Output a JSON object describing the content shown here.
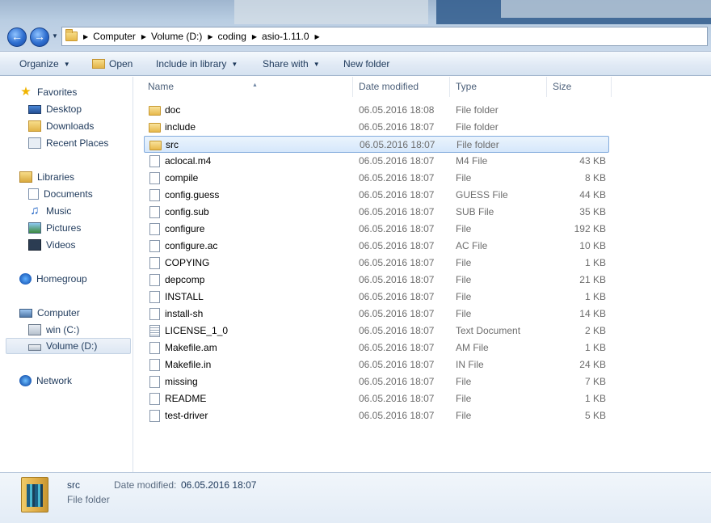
{
  "address": {
    "crumbs": [
      "Computer",
      "Volume (D:)",
      "coding",
      "asio-1.11.0"
    ]
  },
  "toolbar": {
    "organize": "Organize",
    "open": "Open",
    "include_in_library": "Include in library",
    "share_with": "Share with",
    "new_folder": "New folder"
  },
  "nav": {
    "favorites": "Favorites",
    "desktop": "Desktop",
    "downloads": "Downloads",
    "recent_places": "Recent Places",
    "libraries": "Libraries",
    "documents": "Documents",
    "music": "Music",
    "pictures": "Pictures",
    "videos": "Videos",
    "homegroup": "Homegroup",
    "computer": "Computer",
    "win_c": "win (C:)",
    "volume_d": "Volume (D:)",
    "network": "Network"
  },
  "columns": {
    "name": "Name",
    "date_modified": "Date modified",
    "type": "Type",
    "size": "Size"
  },
  "files": [
    {
      "name": "doc",
      "date": "06.05.2016 18:08",
      "type": "File folder",
      "size": "",
      "icon": "folder-icon"
    },
    {
      "name": "include",
      "date": "06.05.2016 18:07",
      "type": "File folder",
      "size": "",
      "icon": "folder-icon"
    },
    {
      "name": "src",
      "date": "06.05.2016 18:07",
      "type": "File folder",
      "size": "",
      "icon": "folder-icon"
    },
    {
      "name": "aclocal.m4",
      "date": "06.05.2016 18:07",
      "type": "M4 File",
      "size": "43 KB",
      "icon": "file-icon"
    },
    {
      "name": "compile",
      "date": "06.05.2016 18:07",
      "type": "File",
      "size": "8 KB",
      "icon": "file-icon"
    },
    {
      "name": "config.guess",
      "date": "06.05.2016 18:07",
      "type": "GUESS File",
      "size": "44 KB",
      "icon": "file-icon"
    },
    {
      "name": "config.sub",
      "date": "06.05.2016 18:07",
      "type": "SUB File",
      "size": "35 KB",
      "icon": "file-icon"
    },
    {
      "name": "configure",
      "date": "06.05.2016 18:07",
      "type": "File",
      "size": "192 KB",
      "icon": "file-icon"
    },
    {
      "name": "configure.ac",
      "date": "06.05.2016 18:07",
      "type": "AC File",
      "size": "10 KB",
      "icon": "file-icon"
    },
    {
      "name": "COPYING",
      "date": "06.05.2016 18:07",
      "type": "File",
      "size": "1 KB",
      "icon": "file-icon"
    },
    {
      "name": "depcomp",
      "date": "06.05.2016 18:07",
      "type": "File",
      "size": "21 KB",
      "icon": "file-icon"
    },
    {
      "name": "INSTALL",
      "date": "06.05.2016 18:07",
      "type": "File",
      "size": "1 KB",
      "icon": "file-icon"
    },
    {
      "name": "install-sh",
      "date": "06.05.2016 18:07",
      "type": "File",
      "size": "14 KB",
      "icon": "file-icon"
    },
    {
      "name": "LICENSE_1_0",
      "date": "06.05.2016 18:07",
      "type": "Text Document",
      "size": "2 KB",
      "icon": "text-document-icon"
    },
    {
      "name": "Makefile.am",
      "date": "06.05.2016 18:07",
      "type": "AM File",
      "size": "1 KB",
      "icon": "file-icon"
    },
    {
      "name": "Makefile.in",
      "date": "06.05.2016 18:07",
      "type": "IN File",
      "size": "24 KB",
      "icon": "file-icon"
    },
    {
      "name": "missing",
      "date": "06.05.2016 18:07",
      "type": "File",
      "size": "7 KB",
      "icon": "file-icon"
    },
    {
      "name": "README",
      "date": "06.05.2016 18:07",
      "type": "File",
      "size": "1 KB",
      "icon": "file-icon"
    },
    {
      "name": "test-driver",
      "date": "06.05.2016 18:07",
      "type": "File",
      "size": "5 KB",
      "icon": "file-icon"
    }
  ],
  "selected_file": "src",
  "details": {
    "name": "src",
    "type": "File folder",
    "date_label": "Date modified:",
    "date_value": "06.05.2016 18:07"
  },
  "colors": {
    "selection_border": "#84acdd",
    "selection_fill": "#d5e7fb",
    "folder": "#e7b94c"
  }
}
